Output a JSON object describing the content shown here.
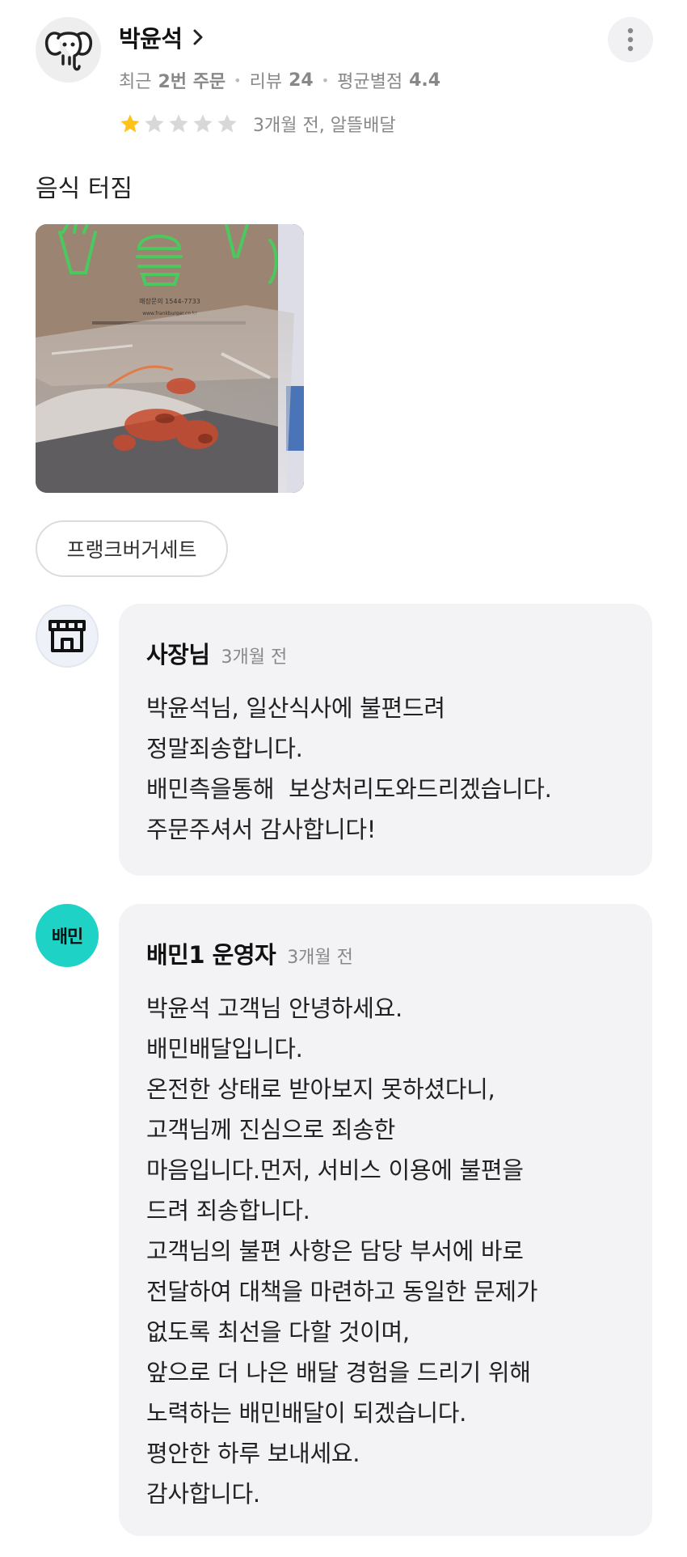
{
  "header": {
    "username": "박윤석",
    "stats": {
      "recent_label": "최근",
      "recent_value": "2번 주문",
      "review_label": "리뷰",
      "review_value": "24",
      "avg_label": "평균별점",
      "avg_value": "4.4"
    }
  },
  "review": {
    "rating": 1,
    "rating_max": 5,
    "meta": "3개월 전, 알뜰배달",
    "text": "음식 터짐",
    "menu_chip": "프랭크버거세트"
  },
  "photo": {
    "print_line1": "매장문의 1544-7733",
    "print_line2": "www.frankburger.co.kr"
  },
  "owner_reply": {
    "name": "사장님",
    "time": "3개월 전",
    "lines": [
      "박윤석님, 일산식사에 불편드려",
      "정말죄송합니다.",
      "배민측을통해  보상처리도와드리겠습니다.",
      "주문주셔서 감사합니다!"
    ]
  },
  "baemin_reply": {
    "avatar_text": "배민",
    "name": "배민1 운영자",
    "time": "3개월 전",
    "lines": [
      "박윤석 고객님 안녕하세요.",
      "배민배달입니다.",
      "온전한 상태로 받아보지 못하셨다니,",
      "고객님께 진심으로 죄송한",
      "마음입니다.먼저, 서비스 이용에 불편을",
      "드려 죄송합니다.",
      "고객님의 불편 사항은 담당 부서에 바로",
      "전달하여 대책을 마련하고 동일한 문제가",
      "없도록 최선을 다할 것이며,",
      "앞으로 더 나은 배달 경험을 드리기 위해",
      "노력하는 배민배달이 되겠습니다.",
      "평안한 하루 보내세요.",
      "감사합니다."
    ]
  },
  "colors": {
    "star_filled": "#ffc21a",
    "star_empty": "#d8d8d8",
    "baemin_mint": "#1ed3c6",
    "bubble_bg": "#f3f3f5",
    "muted_text": "#888888"
  }
}
